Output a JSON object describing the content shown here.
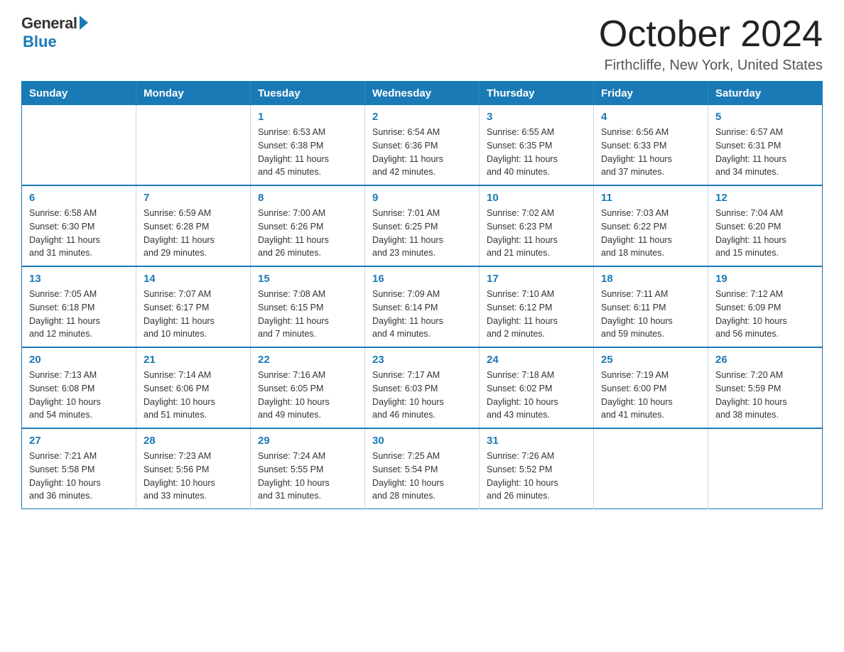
{
  "logo": {
    "general": "General",
    "blue": "Blue"
  },
  "title": "October 2024",
  "location": "Firthcliffe, New York, United States",
  "days_of_week": [
    "Sunday",
    "Monday",
    "Tuesday",
    "Wednesday",
    "Thursday",
    "Friday",
    "Saturday"
  ],
  "weeks": [
    [
      {
        "day": "",
        "info": ""
      },
      {
        "day": "",
        "info": ""
      },
      {
        "day": "1",
        "info": "Sunrise: 6:53 AM\nSunset: 6:38 PM\nDaylight: 11 hours\nand 45 minutes."
      },
      {
        "day": "2",
        "info": "Sunrise: 6:54 AM\nSunset: 6:36 PM\nDaylight: 11 hours\nand 42 minutes."
      },
      {
        "day": "3",
        "info": "Sunrise: 6:55 AM\nSunset: 6:35 PM\nDaylight: 11 hours\nand 40 minutes."
      },
      {
        "day": "4",
        "info": "Sunrise: 6:56 AM\nSunset: 6:33 PM\nDaylight: 11 hours\nand 37 minutes."
      },
      {
        "day": "5",
        "info": "Sunrise: 6:57 AM\nSunset: 6:31 PM\nDaylight: 11 hours\nand 34 minutes."
      }
    ],
    [
      {
        "day": "6",
        "info": "Sunrise: 6:58 AM\nSunset: 6:30 PM\nDaylight: 11 hours\nand 31 minutes."
      },
      {
        "day": "7",
        "info": "Sunrise: 6:59 AM\nSunset: 6:28 PM\nDaylight: 11 hours\nand 29 minutes."
      },
      {
        "day": "8",
        "info": "Sunrise: 7:00 AM\nSunset: 6:26 PM\nDaylight: 11 hours\nand 26 minutes."
      },
      {
        "day": "9",
        "info": "Sunrise: 7:01 AM\nSunset: 6:25 PM\nDaylight: 11 hours\nand 23 minutes."
      },
      {
        "day": "10",
        "info": "Sunrise: 7:02 AM\nSunset: 6:23 PM\nDaylight: 11 hours\nand 21 minutes."
      },
      {
        "day": "11",
        "info": "Sunrise: 7:03 AM\nSunset: 6:22 PM\nDaylight: 11 hours\nand 18 minutes."
      },
      {
        "day": "12",
        "info": "Sunrise: 7:04 AM\nSunset: 6:20 PM\nDaylight: 11 hours\nand 15 minutes."
      }
    ],
    [
      {
        "day": "13",
        "info": "Sunrise: 7:05 AM\nSunset: 6:18 PM\nDaylight: 11 hours\nand 12 minutes."
      },
      {
        "day": "14",
        "info": "Sunrise: 7:07 AM\nSunset: 6:17 PM\nDaylight: 11 hours\nand 10 minutes."
      },
      {
        "day": "15",
        "info": "Sunrise: 7:08 AM\nSunset: 6:15 PM\nDaylight: 11 hours\nand 7 minutes."
      },
      {
        "day": "16",
        "info": "Sunrise: 7:09 AM\nSunset: 6:14 PM\nDaylight: 11 hours\nand 4 minutes."
      },
      {
        "day": "17",
        "info": "Sunrise: 7:10 AM\nSunset: 6:12 PM\nDaylight: 11 hours\nand 2 minutes."
      },
      {
        "day": "18",
        "info": "Sunrise: 7:11 AM\nSunset: 6:11 PM\nDaylight: 10 hours\nand 59 minutes."
      },
      {
        "day": "19",
        "info": "Sunrise: 7:12 AM\nSunset: 6:09 PM\nDaylight: 10 hours\nand 56 minutes."
      }
    ],
    [
      {
        "day": "20",
        "info": "Sunrise: 7:13 AM\nSunset: 6:08 PM\nDaylight: 10 hours\nand 54 minutes."
      },
      {
        "day": "21",
        "info": "Sunrise: 7:14 AM\nSunset: 6:06 PM\nDaylight: 10 hours\nand 51 minutes."
      },
      {
        "day": "22",
        "info": "Sunrise: 7:16 AM\nSunset: 6:05 PM\nDaylight: 10 hours\nand 49 minutes."
      },
      {
        "day": "23",
        "info": "Sunrise: 7:17 AM\nSunset: 6:03 PM\nDaylight: 10 hours\nand 46 minutes."
      },
      {
        "day": "24",
        "info": "Sunrise: 7:18 AM\nSunset: 6:02 PM\nDaylight: 10 hours\nand 43 minutes."
      },
      {
        "day": "25",
        "info": "Sunrise: 7:19 AM\nSunset: 6:00 PM\nDaylight: 10 hours\nand 41 minutes."
      },
      {
        "day": "26",
        "info": "Sunrise: 7:20 AM\nSunset: 5:59 PM\nDaylight: 10 hours\nand 38 minutes."
      }
    ],
    [
      {
        "day": "27",
        "info": "Sunrise: 7:21 AM\nSunset: 5:58 PM\nDaylight: 10 hours\nand 36 minutes."
      },
      {
        "day": "28",
        "info": "Sunrise: 7:23 AM\nSunset: 5:56 PM\nDaylight: 10 hours\nand 33 minutes."
      },
      {
        "day": "29",
        "info": "Sunrise: 7:24 AM\nSunset: 5:55 PM\nDaylight: 10 hours\nand 31 minutes."
      },
      {
        "day": "30",
        "info": "Sunrise: 7:25 AM\nSunset: 5:54 PM\nDaylight: 10 hours\nand 28 minutes."
      },
      {
        "day": "31",
        "info": "Sunrise: 7:26 AM\nSunset: 5:52 PM\nDaylight: 10 hours\nand 26 minutes."
      },
      {
        "day": "",
        "info": ""
      },
      {
        "day": "",
        "info": ""
      }
    ]
  ]
}
